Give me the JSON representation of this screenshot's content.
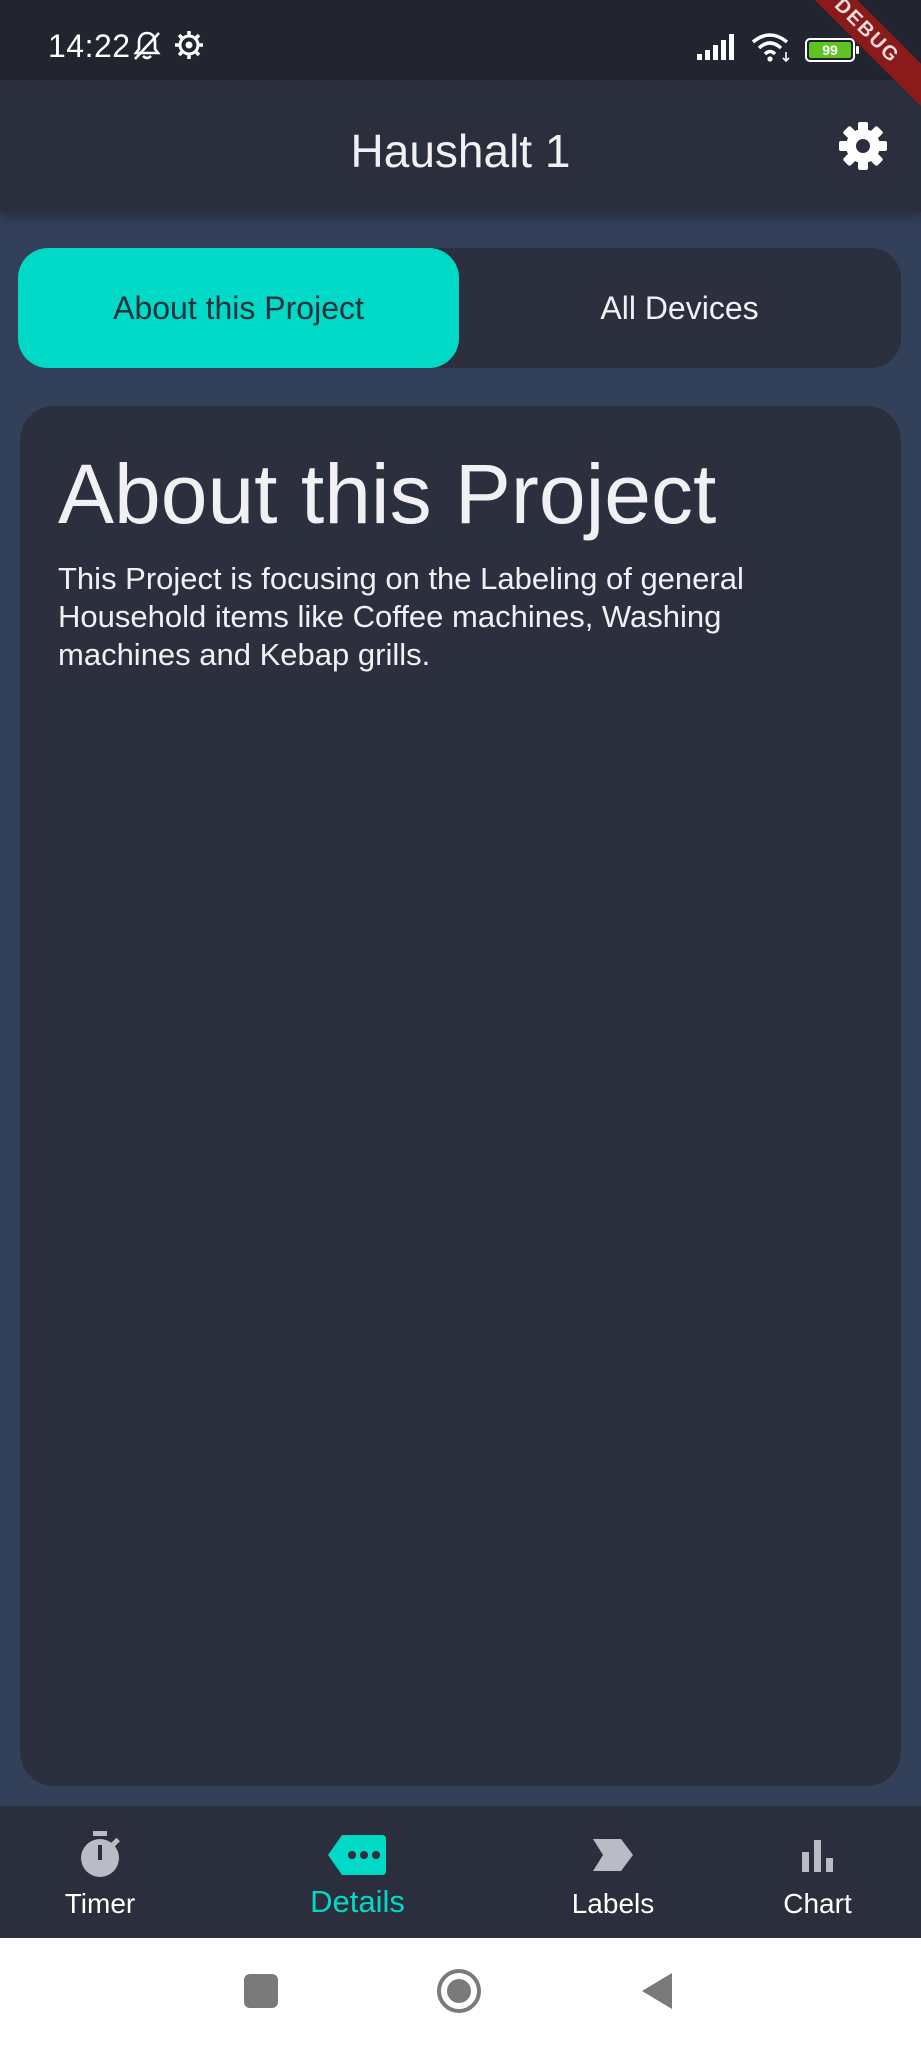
{
  "status_bar": {
    "time": "14:22",
    "battery_level": "99",
    "debug_label": "DEBUG"
  },
  "app_bar": {
    "title": "Haushalt 1",
    "settings_icon": "gear-icon"
  },
  "tabs": [
    {
      "label": "About this Project",
      "active": true
    },
    {
      "label": "All Devices",
      "active": false
    }
  ],
  "about": {
    "title": "About this Project",
    "body": "This Project is focusing on the Labeling of general Household items like Coffee machines, Washing machines and Kebap grills."
  },
  "bottom_nav": {
    "items": [
      {
        "label": "Timer",
        "icon": "stopwatch-icon",
        "active": false
      },
      {
        "label": "Details",
        "icon": "details-tag-icon",
        "active": true
      },
      {
        "label": "Labels",
        "icon": "label-icon",
        "active": false
      },
      {
        "label": "Chart",
        "icon": "bar-chart-icon",
        "active": false
      }
    ]
  },
  "colors": {
    "accent": "#00d9c6",
    "background": "#33405a",
    "surface": "#2c2f3d",
    "text": "#f1f1f4"
  }
}
